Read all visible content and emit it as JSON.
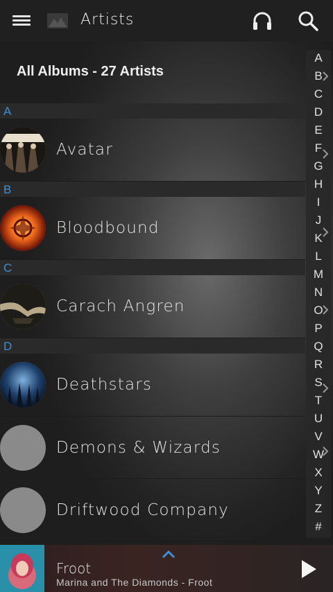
{
  "header": {
    "title": "Artists"
  },
  "summary": "All Albums - 27 Artists",
  "sections": [
    {
      "letter": "A",
      "artists": [
        "Avatar"
      ]
    },
    {
      "letter": "B",
      "artists": [
        "Bloodbound"
      ]
    },
    {
      "letter": "C",
      "artists": [
        "Carach Angren"
      ]
    },
    {
      "letter": "D",
      "artists": [
        "Deathstars",
        "Demons & Wizards",
        "Driftwood Company"
      ]
    }
  ],
  "index": [
    "A",
    "B",
    "C",
    "D",
    "E",
    "F",
    "G",
    "H",
    "I",
    "J",
    "K",
    "L",
    "M",
    "N",
    "O",
    "P",
    "Q",
    "R",
    "S",
    "T",
    "U",
    "V",
    "W",
    "X",
    "Y",
    "Z",
    "#"
  ],
  "player": {
    "title": "Froot",
    "subtitle": "Marina and The Diamonds - Froot"
  },
  "colors": {
    "section_letter": "#3d8fd8",
    "accent": "#3d8fd8"
  },
  "icons": [
    "menu-icon",
    "app-logo-icon",
    "headphones-icon",
    "search-icon",
    "chevron-up-icon",
    "play-icon"
  ]
}
